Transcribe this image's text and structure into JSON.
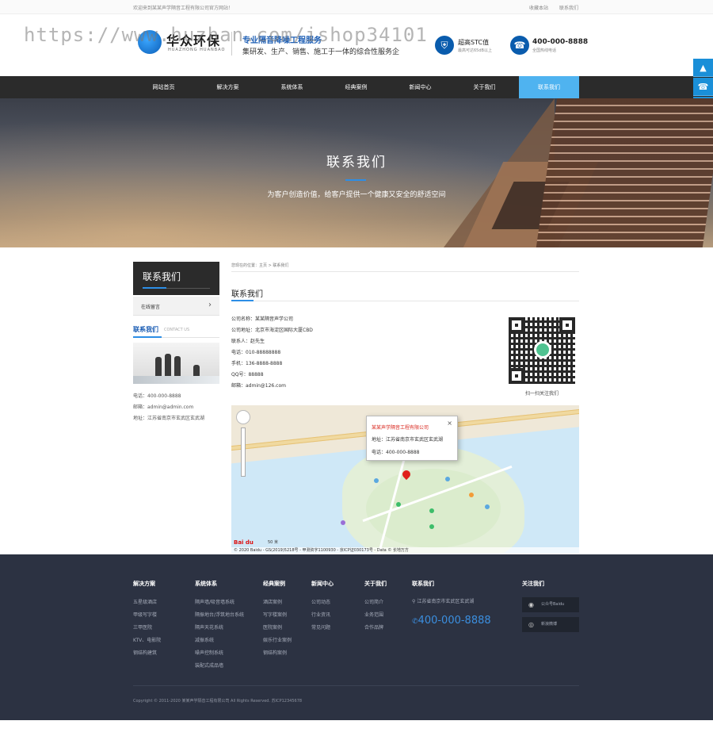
{
  "topbar": {
    "welcome": "欢迎来到某某声学隔音工程有限公司官方网站！",
    "favorite": "收藏本站",
    "contact": "联系我们"
  },
  "watermark": "https://www.huzhan.com/ishop34101",
  "header": {
    "logo_cn": "华众环保",
    "logo_en": "HUAZHONG HUANBAO",
    "slogan_main": "专业隔音降噪工程服务",
    "slogan_sub": "集研发、生产、销售、施工于一体的综合性服务企",
    "stc_title": "超高STC值",
    "stc_sub": "最高可达65dB以上",
    "phone": "400-000-8888",
    "phone_sub": "全国热线电话"
  },
  "nav": [
    {
      "label": "网站首页"
    },
    {
      "label": "解决方案"
    },
    {
      "label": "系统体系"
    },
    {
      "label": "经典案例"
    },
    {
      "label": "新闻中心"
    },
    {
      "label": "关于我们"
    },
    {
      "label": "联系我们"
    }
  ],
  "sidetools": [
    "▲",
    "☎",
    "●",
    "▦"
  ],
  "banner": {
    "title": "联系我们",
    "subtitle": "为客户创造价值，给客户提供一个健康又安全的舒适空间"
  },
  "sidebar": {
    "head": "联系我们",
    "item": "在线留言",
    "item_arrow": "›",
    "contact_title": "联系我们",
    "contact_en": "CONTACT US",
    "tel": "电话：400-000-8888",
    "email": "邮箱：admin@admin.com",
    "addr": "地址：江苏省南京市玄武区玄武湖"
  },
  "main": {
    "breadcrumb": "您现在的位置：主页 > 联系我们",
    "title": "联系我们",
    "rows": [
      "公司名称：某某隔音声学公司",
      "公司地址：北京市海淀区国际大厦CBD",
      "联系人：赵先生",
      "电话：010-88888888",
      "手机：136-8888-8888",
      "QQ号：88888",
      "邮箱：admin@126.com"
    ],
    "qr_caption": "扫一扫关注我们"
  },
  "map": {
    "popup_title": "某某声学隔音工程有限公司",
    "popup_addr": "地址：江苏省南京市玄武区玄武湖",
    "popup_phone": "电话：400-000-8888",
    "close": "×",
    "baidu": "Bai du",
    "scale": "50 米",
    "copyright": "© 2020 Baidu - GS(2019)5218号 - 甲测资字1100930 - 京ICP证030173号 - Data © 长地万方"
  },
  "footer": {
    "columns": [
      {
        "title": "解决方案",
        "items": [
          "五星级酒店",
          "甲级写字楼",
          "三甲医院",
          "KTV、电影院",
          "钢结构建筑"
        ]
      },
      {
        "title": "系统体系",
        "items": [
          "隔声墙/吸音墙系统",
          "隔振地台/浮筑地台系统",
          "隔声天花系统",
          "减振系统",
          "噪声控制系统",
          "装配式成品墙"
        ]
      },
      {
        "title": "经典案例",
        "items": [
          "酒店案例",
          "写字楼案例",
          "医院案例",
          "娱乐行业案例",
          "钢结构案例"
        ]
      },
      {
        "title": "新闻中心",
        "items": [
          "公司动态",
          "行业资讯",
          "常见问题"
        ]
      },
      {
        "title": "关于我们",
        "items": [
          "公司简介",
          "业务范围",
          "合作品牌"
        ]
      }
    ],
    "contact_title": "联系我们",
    "address": "江苏省南京市玄武区玄武湖",
    "phone": "400-000-8888",
    "follow_title": "关注我们",
    "wechat": "公众号Baidu",
    "weibo": "新浪微博",
    "copyright": "Copyright © 2011-2020 某某声学隔音工程有限公司 All Rights Reserved. 苏ICP12345678"
  },
  "colors": {
    "nav_bg": "#2b2b2b",
    "accent": "#4fb3f0",
    "brand_blue": "#1e5fb5",
    "footer_bg": "#2c3242"
  }
}
